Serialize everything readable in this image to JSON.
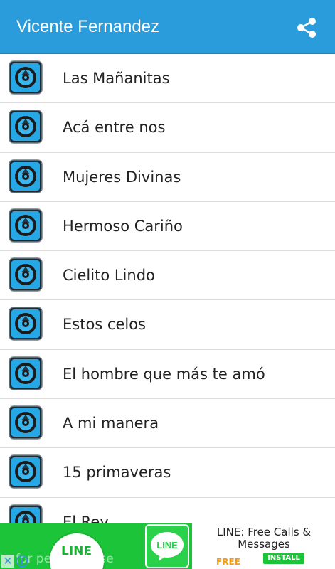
{
  "app_bar": {
    "title": "Vicente Fernandez",
    "share_icon": "share-icon",
    "background": "#2a9cdb"
  },
  "songs": [
    {
      "title": "Las Mañanitas"
    },
    {
      "title": "Acá entre nos"
    },
    {
      "title": "Mujeres Divinas"
    },
    {
      "title": "Hermoso Cariño"
    },
    {
      "title": "Cielito Lindo"
    },
    {
      "title": "Estos celos"
    },
    {
      "title": "El hombre que más te amó"
    },
    {
      "title": "A mi manera"
    },
    {
      "title": "15 primaveras"
    },
    {
      "title": "El Rey"
    }
  ],
  "song_icon": "music-disc-icon",
  "ad": {
    "background": "#1cc43a",
    "brand_small": "LINE",
    "brand_logo": "LINE",
    "overlay_text": "for personal use",
    "title": "LINE: Free Calls & Messages",
    "price": "FREE",
    "install_label": "INSTALL"
  }
}
